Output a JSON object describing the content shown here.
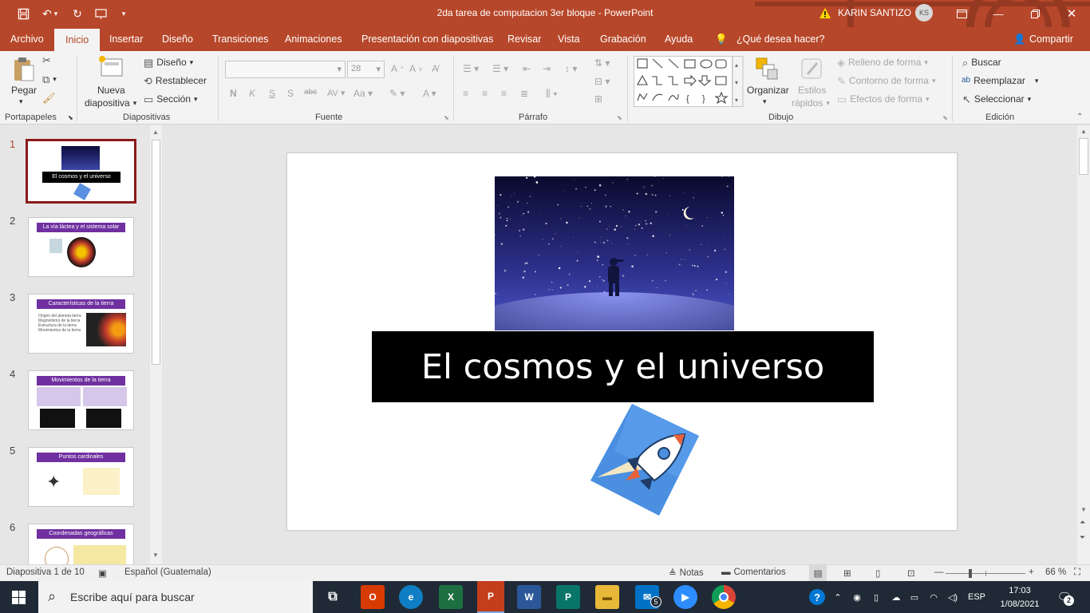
{
  "window": {
    "title": "2da tarea de computacion 3er bloque  -  PowerPoint",
    "user_name": "KARIN SANTIZO",
    "user_initials": "KS",
    "accent": "#b7472a"
  },
  "tabs": [
    "Archivo",
    "Inicio",
    "Insertar",
    "Diseño",
    "Transiciones",
    "Animaciones",
    "Presentación con diapositivas",
    "Revisar",
    "Vista",
    "Grabación",
    "Ayuda"
  ],
  "tell_me": "¿Qué desea hacer?",
  "share_label": "Compartir",
  "ribbon": {
    "groups": {
      "portapapeles": "Portapapeles",
      "diapositivas": "Diapositivas",
      "fuente": "Fuente",
      "parrafo": "Párrafo",
      "dibujo": "Dibujo",
      "edicion": "Edición"
    },
    "pegar": "Pegar",
    "nueva": "Nueva",
    "diapositiva": "diapositiva",
    "diseno": "Diseño",
    "restablecer": "Restablecer",
    "seccion": "Sección",
    "font_size": "28",
    "organizar": "Organizar",
    "estilos": "Estilos",
    "rapidos": "rápidos",
    "relleno": "Relleno de forma",
    "contorno": "Contorno de forma",
    "efectos": "Efectos de forma",
    "buscar": "Buscar",
    "reemplazar": "Reemplazar",
    "seleccionar": "Seleccionar"
  },
  "slides": [
    {
      "num": "1",
      "title": "El cosmos y el universo"
    },
    {
      "num": "2",
      "title": "La vía láctea y el sistema solar"
    },
    {
      "num": "3",
      "title": "Características de la tierra",
      "bullets": [
        "Origen del planeta tierra",
        "Magnetismo de la tierra",
        "Estructura de la tierra",
        "Movimientos de la tierra"
      ]
    },
    {
      "num": "4",
      "title": "Movimientos de la tierra"
    },
    {
      "num": "5",
      "title": "Puntos cardinales"
    },
    {
      "num": "6",
      "title": "Coordenadas geográficas"
    }
  ],
  "current_slide": {
    "title": "El cosmos y el universo"
  },
  "status": {
    "slide_info": "Diapositiva 1 de 10",
    "language": "Español (Guatemala)",
    "notes": "Notas",
    "comments": "Comentarios",
    "zoom": "66 %",
    "zoom_level": 0.66
  },
  "taskbar": {
    "search_placeholder": "Escribe aquí para buscar",
    "mail_badge": "5",
    "lang": "ESP",
    "time": "17:03",
    "date": "1/08/2021",
    "notif_count": "2"
  }
}
